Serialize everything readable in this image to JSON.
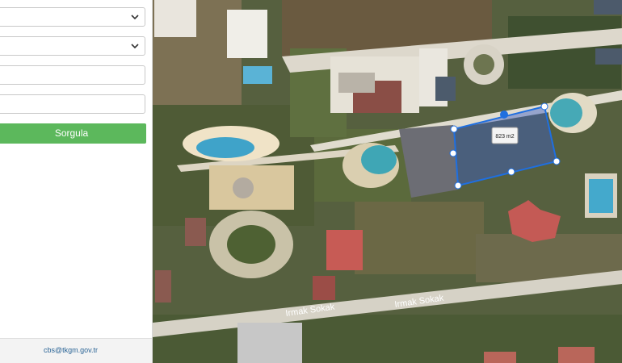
{
  "panel": {
    "select1": {
      "value": ""
    },
    "select2": {
      "value": ""
    },
    "input1": {
      "value": "",
      "placeholder": ""
    },
    "input2": {
      "value": "",
      "placeholder": ""
    },
    "query_button": "Sorgula",
    "footer_email": "cbs@tkgm.gov.tr"
  },
  "map": {
    "area_label": "823 m2",
    "streets": [
      "Irmak Sokak",
      "Irmak Sokak"
    ],
    "selection_color": "#1f6fe0"
  }
}
